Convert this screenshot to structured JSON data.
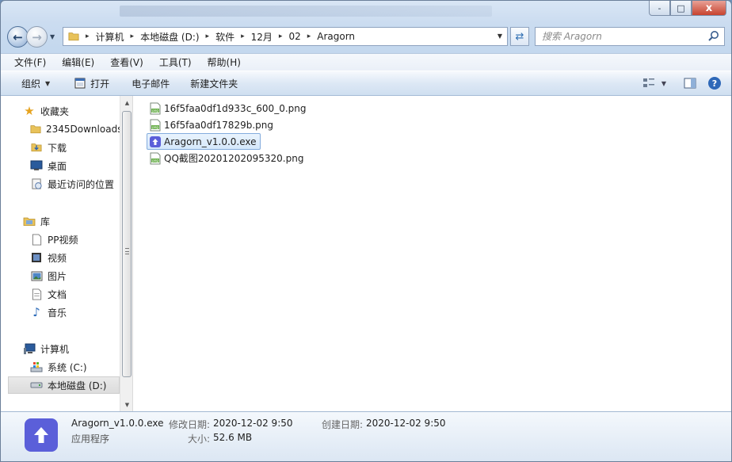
{
  "window": {
    "controls": {
      "minimize": "-",
      "maximize": "□",
      "close": "x"
    }
  },
  "navigation": {
    "breadcrumbs": [
      "计算机",
      "本地磁盘 (D:)",
      "软件",
      "12月",
      "02",
      "Aragorn"
    ],
    "search_placeholder": "搜索 Aragorn"
  },
  "menubar": {
    "items": [
      "文件(F)",
      "编辑(E)",
      "查看(V)",
      "工具(T)",
      "帮助(H)"
    ]
  },
  "toolbar": {
    "organize": "组织",
    "open": "打开",
    "email": "电子邮件",
    "new_folder": "新建文件夹"
  },
  "sidebar": {
    "favorites": {
      "label": "收藏夹",
      "items": [
        "2345Downloads",
        "下载",
        "桌面",
        "最近访问的位置"
      ]
    },
    "libraries": {
      "label": "库",
      "items": [
        "PP视频",
        "视频",
        "图片",
        "文档",
        "音乐"
      ]
    },
    "computer": {
      "label": "计算机",
      "items": [
        "系统 (C:)",
        "本地磁盘 (D:)"
      ],
      "selected": "本地磁盘 (D:)"
    }
  },
  "files": [
    {
      "name": "16f5faa0df1d933c_600_0.png",
      "type": "png",
      "selected": false
    },
    {
      "name": "16f5faa0df17829b.png",
      "type": "png",
      "selected": false
    },
    {
      "name": "Aragorn_v1.0.0.exe",
      "type": "exe",
      "selected": true
    },
    {
      "name": "QQ截图20201202095320.png",
      "type": "png",
      "selected": false
    }
  ],
  "details": {
    "name": "Aragorn_v1.0.0.exe",
    "type": "应用程序",
    "modified_label": "修改日期:",
    "modified_value": "2020-12-02 9:50",
    "size_label": "大小:",
    "size_value": "52.6 MB",
    "created_label": "创建日期:",
    "created_value": "2020-12-02 9:50"
  },
  "colors": {
    "app_icon": "#5b5fd9",
    "selection_border": "#84acdd",
    "toolbar_bg": "#dde8f5"
  }
}
